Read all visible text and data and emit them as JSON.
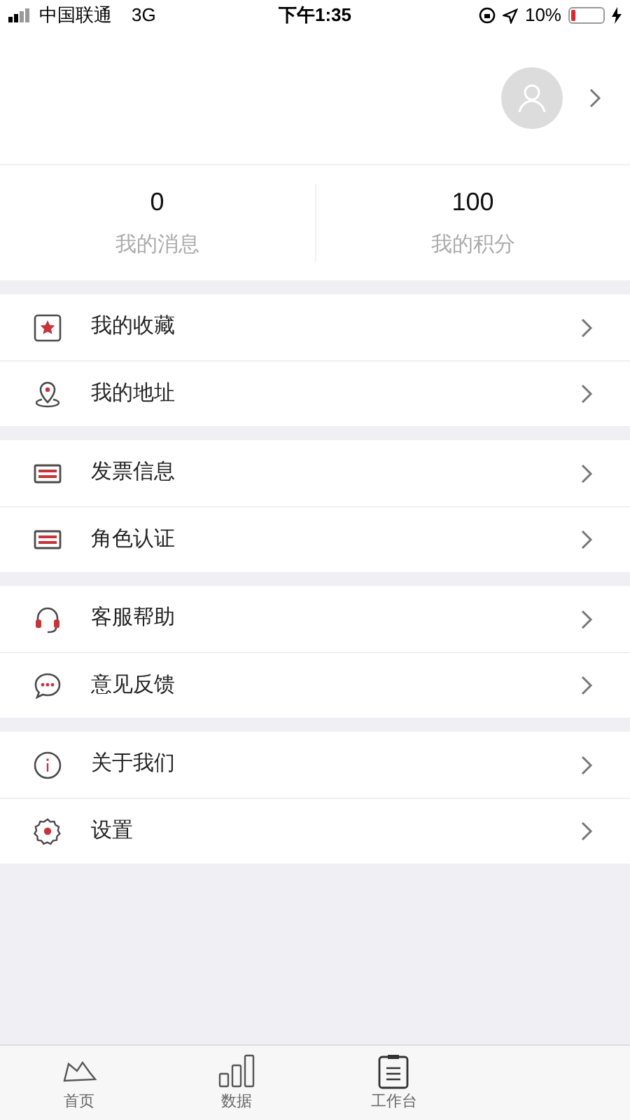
{
  "status_bar": {
    "carrier": "中国联通",
    "network": "3G",
    "time": "下午1:35",
    "battery": "10%"
  },
  "stats": [
    {
      "value": "0",
      "label": "我的消息"
    },
    {
      "value": "100",
      "label": "我的积分"
    }
  ],
  "menu_groups": [
    [
      {
        "kind": "star",
        "label": "我的收藏"
      },
      {
        "kind": "pin",
        "label": "我的地址"
      }
    ],
    [
      {
        "kind": "card",
        "label": "发票信息"
      },
      {
        "kind": "card",
        "label": "角色认证"
      }
    ],
    [
      {
        "kind": "headset",
        "label": "客服帮助"
      },
      {
        "kind": "chat",
        "label": "意见反馈"
      }
    ],
    [
      {
        "kind": "info",
        "label": "关于我们"
      },
      {
        "kind": "gear",
        "label": "设置"
      }
    ]
  ],
  "tab_bar": [
    {
      "kind": "home",
      "label": "首页"
    },
    {
      "kind": "bars",
      "label": "数据"
    },
    {
      "kind": "clipboard",
      "label": "工作台"
    }
  ]
}
